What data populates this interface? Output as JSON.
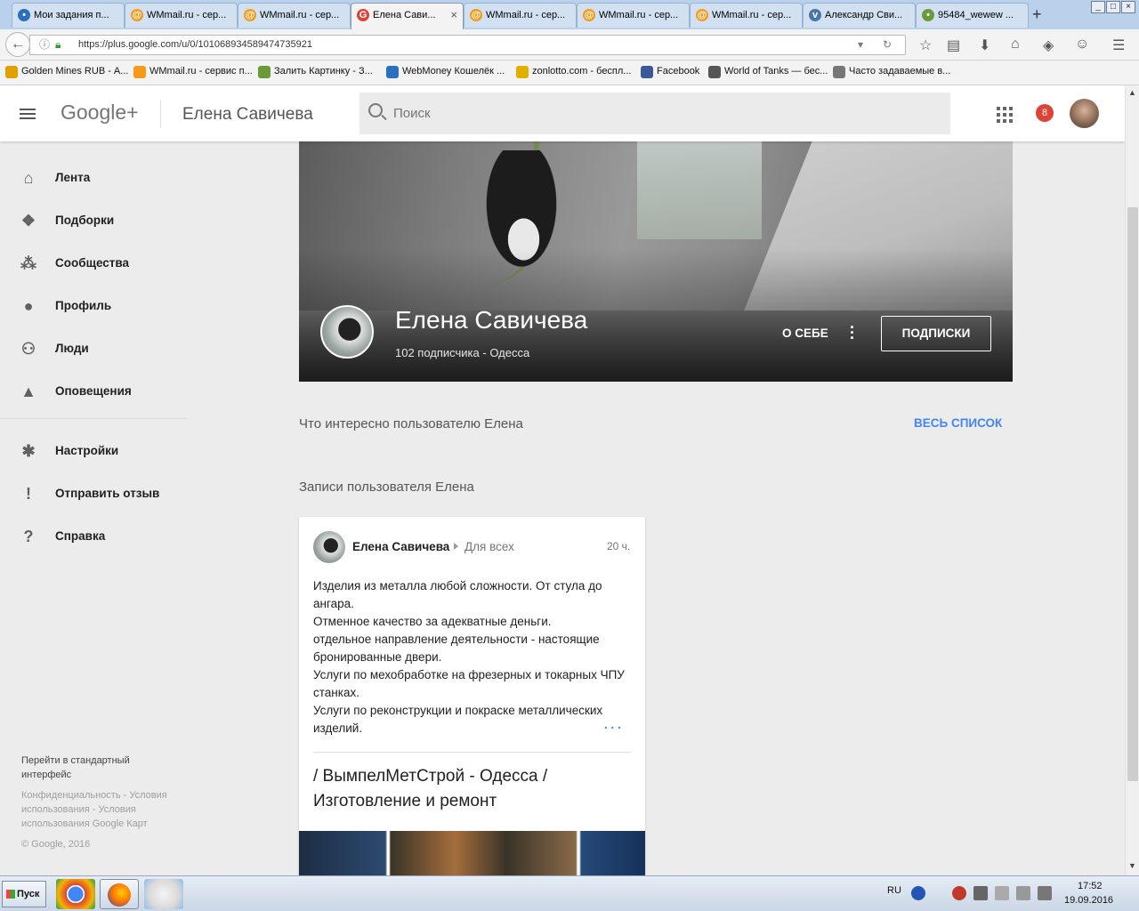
{
  "browser": {
    "tabs": [
      {
        "title": "Мои задания п...",
        "icon": "target-icon",
        "color": "#2c6fbd"
      },
      {
        "title": "WMmail.ru - сер...",
        "icon": "at-icon",
        "color": "#f59a1b"
      },
      {
        "title": "WMmail.ru - сер...",
        "icon": "at-icon",
        "color": "#f59a1b"
      },
      {
        "title": "Елена Сави...",
        "icon": "gplus-icon",
        "color": "#db4437",
        "active": true
      },
      {
        "title": "WMmail.ru - сер...",
        "icon": "at-icon",
        "color": "#f59a1b"
      },
      {
        "title": "WMmail.ru - сер...",
        "icon": "at-icon",
        "color": "#f59a1b"
      },
      {
        "title": "WMmail.ru - сер...",
        "icon": "at-icon",
        "color": "#f59a1b"
      },
      {
        "title": "Александр Сви...",
        "icon": "vk-icon",
        "color": "#4a76a8"
      },
      {
        "title": "95484_wewew ...",
        "icon": "image-icon",
        "color": "#6a9a3a"
      }
    ],
    "new_tab": "+",
    "url": "https://plus.google.com/u/0/101068934589474735921",
    "bookmarks": [
      {
        "label": "Golden Mines RUB - А...",
        "icon": "dollar-icon",
        "color": "#e0a000"
      },
      {
        "label": "WMmail.ru - сервис п...",
        "icon": "at-icon",
        "color": "#f59a1b"
      },
      {
        "label": "Залить Картинку - З...",
        "icon": "image-icon",
        "color": "#6a9a3a"
      },
      {
        "label": "WebMoney Кошелёк ...",
        "icon": "webmoney-icon",
        "color": "#2c6fbd"
      },
      {
        "label": "zonlotto.com - беспл...",
        "icon": "ruble-icon",
        "color": "#e0b000"
      },
      {
        "label": "Facebook",
        "icon": "facebook-icon",
        "color": "#3b5998"
      },
      {
        "label": "World of Tanks — бес...",
        "icon": "wot-icon",
        "color": "#555"
      },
      {
        "label": "Часто задаваемые в...",
        "icon": "page-icon",
        "color": "#777"
      }
    ]
  },
  "header": {
    "logo": "Google+",
    "title": "Елена Савичева",
    "search_placeholder": "Поиск",
    "notifications": "8"
  },
  "nav": {
    "items": [
      {
        "label": "Лента",
        "icon": "home-icon",
        "glyph": "⌂"
      },
      {
        "label": "Подборки",
        "icon": "collections-icon",
        "glyph": "❖"
      },
      {
        "label": "Сообщества",
        "icon": "communities-icon",
        "glyph": "⁂"
      },
      {
        "label": "Профиль",
        "icon": "profile-icon",
        "glyph": "●"
      },
      {
        "label": "Люди",
        "icon": "people-icon",
        "glyph": "⚇"
      },
      {
        "label": "Оповещения",
        "icon": "bell-icon",
        "glyph": "▲"
      },
      {
        "label": "Настройки",
        "icon": "gear-icon",
        "glyph": "✱"
      },
      {
        "label": "Отправить отзыв",
        "icon": "feedback-icon",
        "glyph": "!"
      },
      {
        "label": "Справка",
        "icon": "help-icon",
        "glyph": "?"
      }
    ],
    "footer": {
      "classic": "Перейти в стандартный интерфейс",
      "links": "Конфиденциальность - Условия использования - Условия использования Google Карт",
      "copyright": "© Google, 2016"
    }
  },
  "profile": {
    "name": "Елена Савичева",
    "meta": "102 подписчика - Одесса",
    "about": "О СЕБЕ",
    "follows": "ПОДПИСКИ"
  },
  "sections": {
    "interests": "Что интересно пользователю Елена",
    "all_list": "ВЕСЬ СПИСОК",
    "posts": "Записи пользователя Елена"
  },
  "post": {
    "author": "Елена Савичева",
    "audience": "Для всех",
    "time": "20 ч.",
    "lines": [
      "Изделия из металла любой сложности. От стула до ангара.",
      "Отменное качество за адекватные деньги.",
      "отдельное направление деятельности - настоящие бронированные двери.",
      "Услуги по мехобработке на фрезерных и токарных ЧПУ станках.",
      "Услуги по реконструкции и покраске металлических изделий."
    ],
    "more": "...",
    "link_title": "/ ВымпелМетСтрой - Одесса / Изготовление и ремонт"
  },
  "taskbar": {
    "start": "Пуск",
    "lang": "RU",
    "time": "17:52",
    "date": "19.09.2016"
  }
}
